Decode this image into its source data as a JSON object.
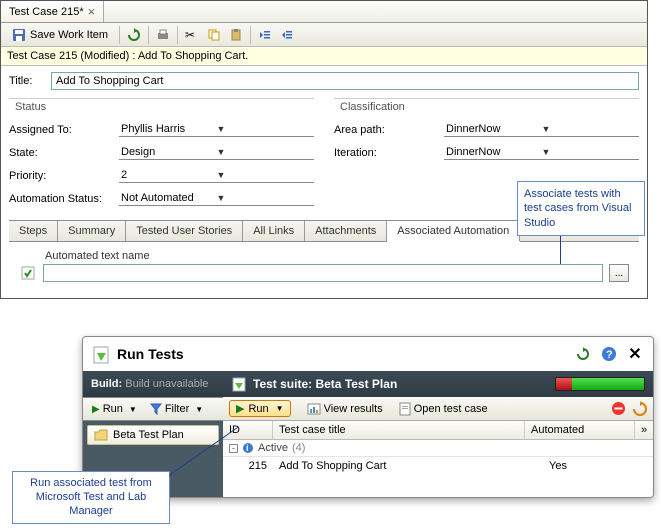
{
  "window": {
    "tab_title": "Test Case 215*"
  },
  "toolbar": {
    "save_label": "Save Work Item"
  },
  "infobar": "Test Case 215 (Modified) : Add To Shopping Cart.",
  "form": {
    "title_label": "Title:",
    "title_value": "Add To Shopping Cart ",
    "status": {
      "legend": "Status",
      "assigned_to": {
        "label": "Assigned To:",
        "value": "Phyllis Harris"
      },
      "state": {
        "label": "State:",
        "value": "Design"
      },
      "priority": {
        "label": "Priority:",
        "value": "2"
      },
      "automation_status": {
        "label": "Automation Status:",
        "value": "Not Automated"
      }
    },
    "classification": {
      "legend": "Classification",
      "area": {
        "label": "Area path:",
        "value": "DinnerNow"
      },
      "iteration": {
        "label": "Iteration:",
        "value": "DinnerNow"
      }
    }
  },
  "inner_tabs": {
    "steps": "Steps",
    "summary": "Summary",
    "tested": "Tested User Stories",
    "links": "All Links",
    "attachments": "Attachments",
    "assoc": "Associated Automation"
  },
  "assoc_auto": {
    "label": "Automated text name",
    "picker": "..."
  },
  "callout1": "Associate tests with test cases from Visual Studio",
  "callout2": "Run associated test from Microsoft Test and Lab Manager",
  "runpanel": {
    "title": "Run Tests",
    "build_label": "Build:",
    "build_value": "Build unavailable",
    "run": "Run",
    "filter": "Filter",
    "plan_item": "Beta Test Plan",
    "suite_label": "Test suite:",
    "suite_value": "Beta Test Plan",
    "view_results": "View results",
    "open_case": "Open test case",
    "columns": {
      "id": "ID",
      "title": "Test case title",
      "auto": "Automated"
    },
    "group": {
      "name": "Active",
      "count": "(4)"
    },
    "row": {
      "id": "215",
      "title": "Add To Shopping Cart",
      "auto": "Yes"
    }
  }
}
